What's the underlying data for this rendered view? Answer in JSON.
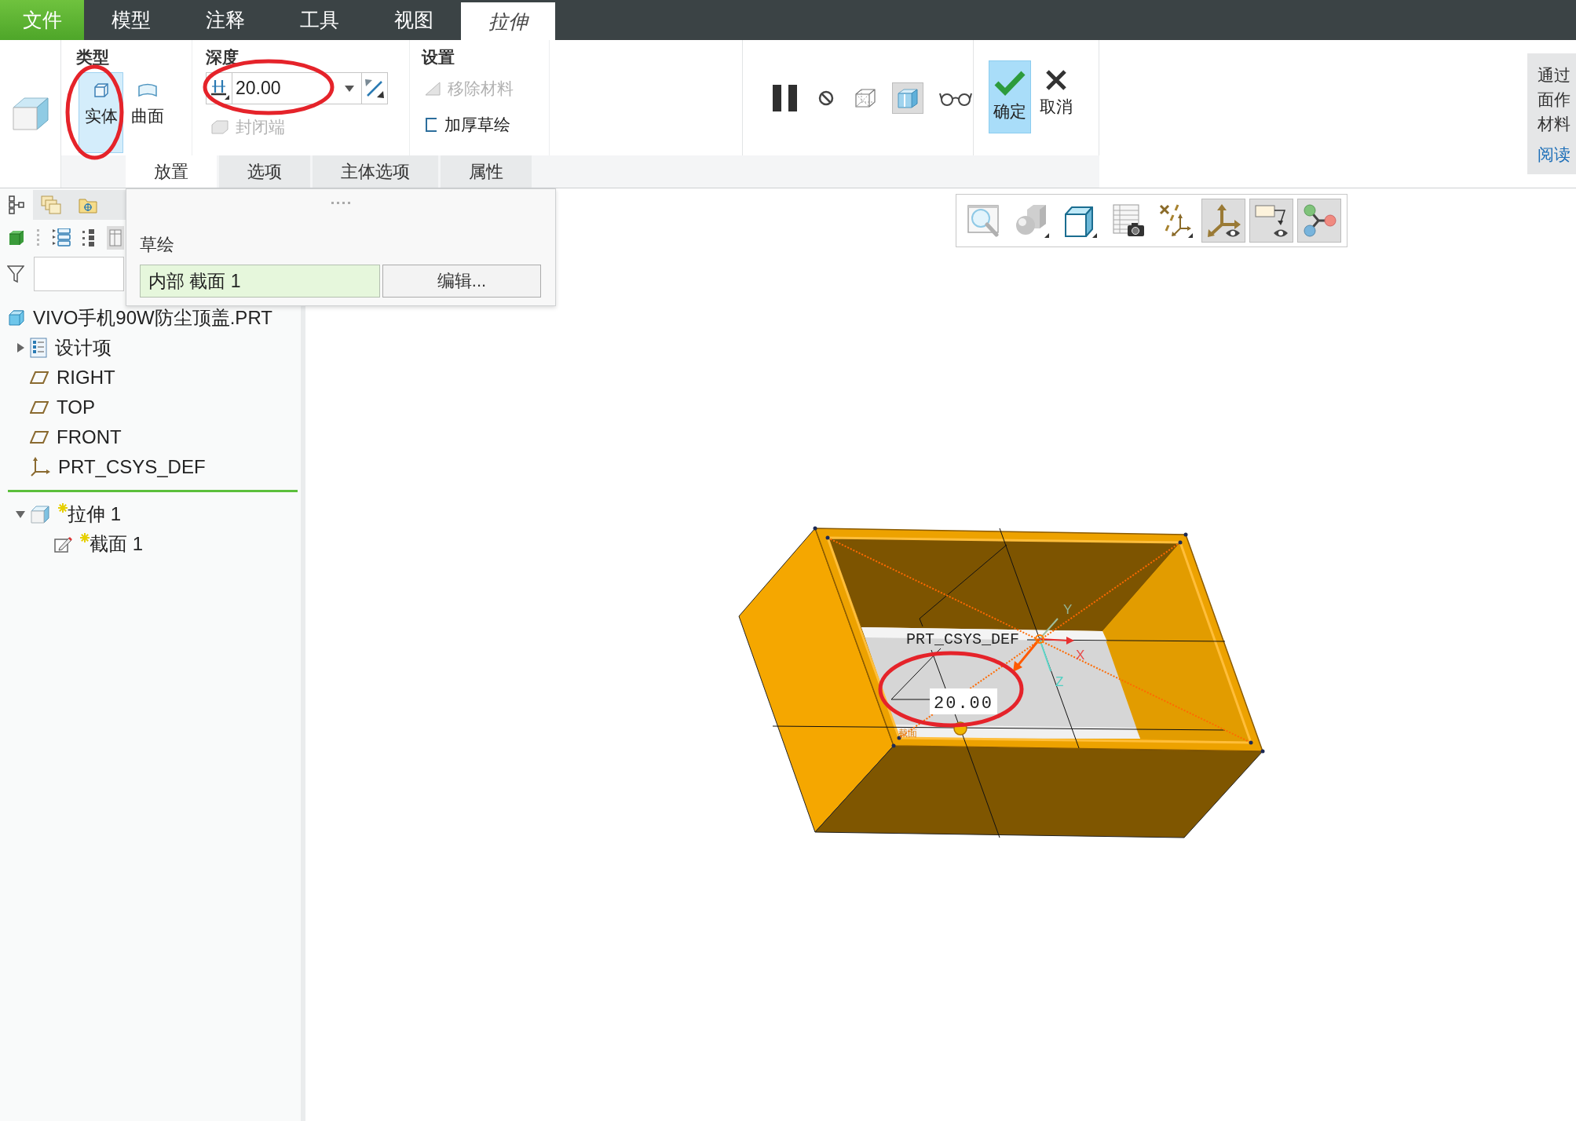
{
  "menu": {
    "tabs": [
      {
        "label": "文件",
        "kind": "file",
        "selected": false
      },
      {
        "label": "模型",
        "kind": "tab",
        "selected": false
      },
      {
        "label": "注释",
        "kind": "tab",
        "selected": false
      },
      {
        "label": "工具",
        "kind": "tab",
        "selected": false
      },
      {
        "label": "视图",
        "kind": "tab",
        "selected": false
      },
      {
        "label": "拉伸",
        "kind": "tab",
        "selected": true
      }
    ]
  },
  "ribbon": {
    "type_group": {
      "title": "类型",
      "options": [
        {
          "label": "实体",
          "kind": "solid",
          "selected": true,
          "highlight": true
        },
        {
          "label": "曲面",
          "kind": "surface",
          "selected": false,
          "highlight": false
        }
      ]
    },
    "depth_group": {
      "title": "深度",
      "depth": {
        "value": "20.00",
        "highlight": true
      },
      "capped_ends": {
        "label": "封闭端",
        "disabled": true
      }
    },
    "settings_group": {
      "title": "设置",
      "options": [
        {
          "label": "移除材料",
          "kind": "remove-material",
          "disabled": true
        },
        {
          "label": "加厚草绘",
          "kind": "thicken",
          "disabled": false
        }
      ]
    },
    "tools": [
      {
        "kind": "pause",
        "on": false
      },
      {
        "kind": "no-entry",
        "on": false
      },
      {
        "kind": "wireframe",
        "on": false
      },
      {
        "kind": "preview",
        "on": true
      },
      {
        "kind": "glasses",
        "on": false
      }
    ],
    "actions": [
      {
        "label": "确定",
        "kind": "ok"
      },
      {
        "label": "取消",
        "kind": "cancel"
      }
    ],
    "panel_tabs": [
      {
        "label": "放置",
        "selected": true
      },
      {
        "label": "选项",
        "selected": false
      },
      {
        "label": "主体选项",
        "selected": false
      },
      {
        "label": "属性",
        "selected": false
      }
    ],
    "help": {
      "lines": [
        "通过",
        "面作",
        "材料"
      ],
      "link": "阅读"
    }
  },
  "placement_panel": {
    "heading": "草绘",
    "sketch": "内部 截面 1",
    "edit_button": "编辑..."
  },
  "navigator": {
    "tabs": [
      {
        "kind": "model-tree",
        "selected": true
      },
      {
        "kind": "layers",
        "selected": false
      },
      {
        "kind": "folder",
        "selected": false
      }
    ]
  },
  "model_tree": {
    "root": {
      "label": "VIVO手机90W防尘顶盖.PRT",
      "kind": "part",
      "new": false,
      "children": [
        {
          "label": "设计项",
          "kind": "design-items",
          "expanded": false,
          "new": false
        },
        {
          "label": "RIGHT",
          "kind": "plane",
          "new": false
        },
        {
          "label": "TOP",
          "kind": "plane",
          "new": false
        },
        {
          "label": "FRONT",
          "kind": "plane",
          "new": false
        },
        {
          "label": "PRT_CSYS_DEF",
          "kind": "csys",
          "new": false
        },
        {
          "kind": "insert-marker"
        },
        {
          "label": "拉伸 1",
          "kind": "extrude",
          "expanded": true,
          "new": true,
          "children": [
            {
              "label": "截面 1",
              "kind": "sketch",
              "new": true
            }
          ]
        }
      ]
    }
  },
  "viewport": {
    "toolbar": [
      {
        "kind": "refit",
        "on": false
      },
      {
        "kind": "appearance",
        "on": false
      },
      {
        "kind": "display-style",
        "on": false
      },
      {
        "kind": "saved-views",
        "on": false
      },
      {
        "kind": "datum-display",
        "on": false
      },
      {
        "kind": "csys-display",
        "on": true
      },
      {
        "kind": "annotation-display",
        "on": true
      },
      {
        "kind": "spin-center",
        "on": true
      }
    ],
    "model": {
      "csys_label": "PRT_CSYS_DEF",
      "axes": [
        "X",
        "Y",
        "Z"
      ],
      "dimension": {
        "value": "20.00",
        "highlight": true
      },
      "section_label": "截面"
    }
  }
}
